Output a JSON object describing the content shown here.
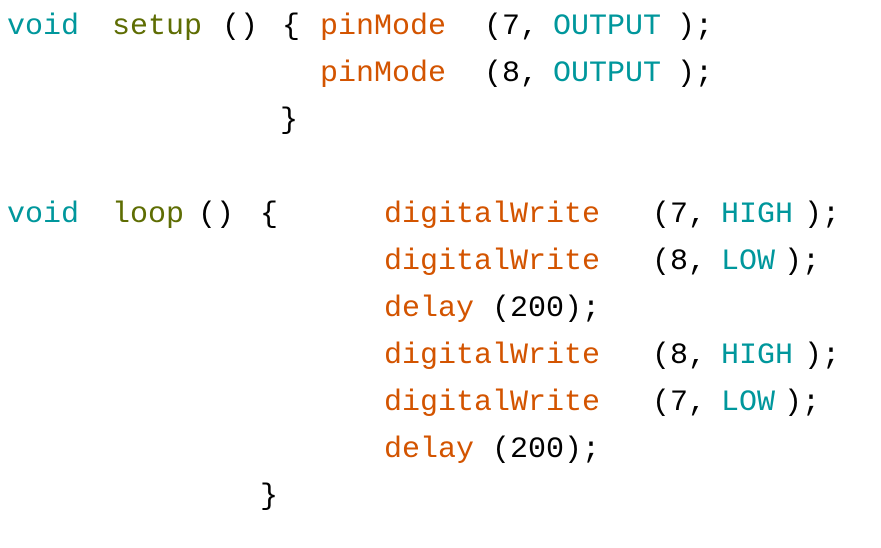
{
  "colors": {
    "keyword": "#00979c",
    "function_name": "#5e6d03",
    "builtin_call": "#d35400",
    "constant": "#00979c",
    "plain": "#000000"
  },
  "code": {
    "setup": {
      "keyword": "void",
      "name": "setup",
      "parens": "()",
      "open_brace": "{",
      "lines": [
        {
          "call": "pinMode",
          "open": " (7,",
          "arg": "OUTPUT",
          "close": ");"
        },
        {
          "call": "pinMode",
          "open": " (8,",
          "arg": "OUTPUT",
          "close": ");"
        }
      ],
      "close_brace": "}"
    },
    "loop": {
      "keyword": "void",
      "name": "loop",
      "parens": "()",
      "open_brace": "{",
      "lines": [
        {
          "call": "digitalWrite",
          "open": " (7,",
          "arg": "HIGH",
          "close": ");"
        },
        {
          "call": "digitalWrite",
          "open": " (8,",
          "arg": "LOW",
          "close": ");"
        },
        {
          "call": "delay",
          "open": "(200);",
          "arg": "",
          "close": ""
        },
        {
          "call": "digitalWrite",
          "open": " (8,",
          "arg": "HIGH",
          "close": ");"
        },
        {
          "call": "digitalWrite",
          "open": " (7,",
          "arg": "LOW",
          "close": ");"
        },
        {
          "call": "delay",
          "open": "(200);",
          "arg": "",
          "close": ""
        }
      ],
      "close_brace": "}"
    }
  }
}
